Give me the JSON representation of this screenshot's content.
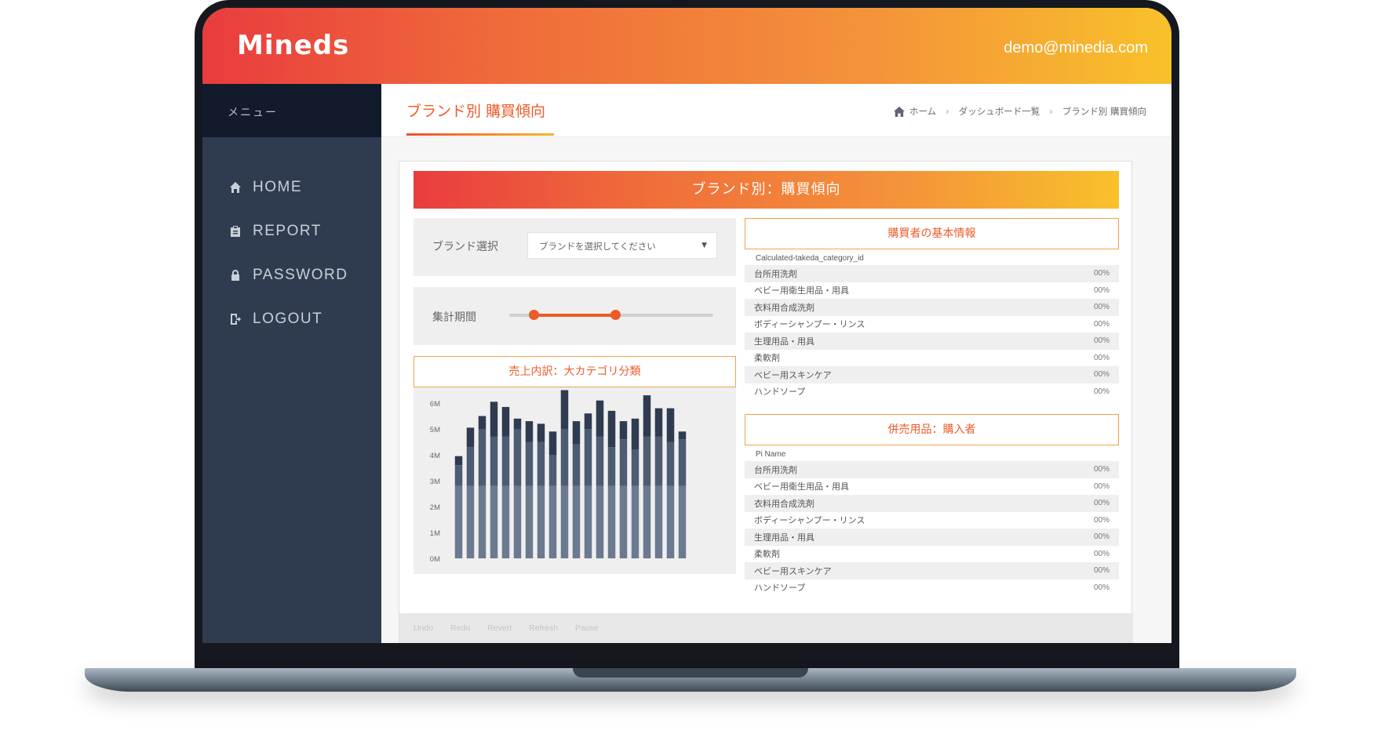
{
  "app": {
    "logo": "Mineds",
    "user_email": "demo@minedia.com"
  },
  "sidebar": {
    "menu_label": "メニュー",
    "items": [
      {
        "label": "HOME",
        "icon": "home-icon"
      },
      {
        "label": "REPORT",
        "icon": "clipboard-icon"
      },
      {
        "label": "PASSWORD",
        "icon": "lock-icon"
      },
      {
        "label": "LOGOUT",
        "icon": "logout-icon"
      }
    ]
  },
  "page": {
    "title": "ブランド別 購買傾向",
    "breadcrumb": [
      "ホーム",
      "ダッシュボード一覧",
      "ブランド別 購買傾向"
    ]
  },
  "report": {
    "banner": "ブランド別：購買傾向",
    "brand_label": "ブランド選択",
    "brand_placeholder": "ブランドを選択してください",
    "period_label": "集計期間",
    "slider": {
      "min": 0,
      "max": 1,
      "low": 0.12,
      "high": 0.52
    },
    "chart_title": "売上内訳：大カテゴリ分類",
    "buyer_info_title": "購買者の基本情報",
    "buyer_info_column": "Calculated-takeda_category_id",
    "buyer_rows": [
      {
        "name": "台所用洗剤",
        "pct": "00%"
      },
      {
        "name": "ベビー用衛生用品・用具",
        "pct": "00%"
      },
      {
        "name": "衣料用合成洗剤",
        "pct": "00%"
      },
      {
        "name": "ボディーシャンプー・リンス",
        "pct": "00%"
      },
      {
        "name": "生理用品・用具",
        "pct": "00%"
      },
      {
        "name": "柔軟剤",
        "pct": "00%"
      },
      {
        "name": "ベビー用スキンケア",
        "pct": "00%"
      },
      {
        "name": "ハンドソープ",
        "pct": "00%"
      }
    ],
    "cosale_title": "併売用品：購入者",
    "cosale_column": "Pi Name",
    "cosale_rows": [
      {
        "name": "台所用洗剤",
        "pct": "00%"
      },
      {
        "name": "ベビー用衛生用品・用具",
        "pct": "00%"
      },
      {
        "name": "衣料用合成洗剤",
        "pct": "00%"
      },
      {
        "name": "ボディーシャンプー・リンス",
        "pct": "00%"
      },
      {
        "name": "生理用品・用具",
        "pct": "00%"
      },
      {
        "name": "柔軟剤",
        "pct": "00%"
      },
      {
        "name": "ベビー用スキンケア",
        "pct": "00%"
      },
      {
        "name": "ハンドソープ",
        "pct": "00%"
      }
    ],
    "footer_links": [
      "Undo",
      "Redo",
      "Revert",
      "Refresh",
      "Pause"
    ]
  },
  "chart_data": {
    "type": "bar",
    "stacked": true,
    "y_ticks": [
      "0M",
      "1M",
      "2M",
      "3M",
      "4M",
      "5M",
      "6M"
    ],
    "ylim": [
      0,
      6
    ],
    "colors": [
      "#6b7a90",
      "#4d5b73",
      "#2f3b50"
    ],
    "series": [
      {
        "values": [
          2.8,
          2.8,
          2.8,
          2.8,
          2.8,
          2.8,
          2.8,
          2.8,
          2.8,
          2.8,
          2.8,
          2.8,
          2.8,
          2.8,
          2.8,
          2.8,
          2.8,
          2.8,
          2.8,
          2.8
        ]
      },
      {
        "values": [
          0.8,
          1.5,
          2.2,
          1.9,
          1.9,
          2.2,
          1.7,
          1.7,
          1.2,
          2.2,
          1.6,
          2.2,
          1.9,
          1.5,
          1.8,
          1.4,
          1.9,
          1.9,
          1.7,
          1.8
        ]
      },
      {
        "values": [
          0.35,
          0.75,
          0.5,
          1.35,
          1.15,
          0.4,
          0.8,
          0.7,
          0.9,
          1.5,
          0.9,
          0.6,
          1.4,
          1.4,
          0.7,
          1.2,
          1.6,
          1.1,
          1.3,
          0.3
        ]
      }
    ]
  }
}
